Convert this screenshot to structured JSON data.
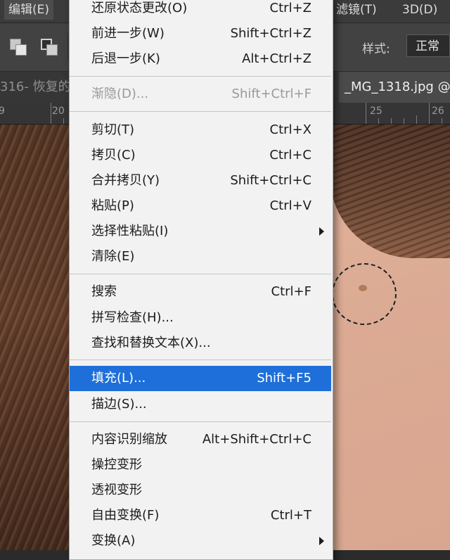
{
  "menubar": {
    "edit": "编辑(E)",
    "filter": "滤镜(T)",
    "threed": "3D(D)"
  },
  "options_bar": {
    "style_label": "样式:",
    "style_value": "正常"
  },
  "tabs": {
    "left": "316- 恢复的",
    "right": "_MG_1318.jpg @"
  },
  "ruler": {
    "labels": [
      "9",
      "20",
      "25",
      "26"
    ]
  },
  "edit_menu": {
    "items": [
      {
        "label": "还原状态更改(O)",
        "shortcut": "Ctrl+Z"
      },
      {
        "label": "前进一步(W)",
        "shortcut": "Shift+Ctrl+Z"
      },
      {
        "label": "后退一步(K)",
        "shortcut": "Alt+Ctrl+Z"
      },
      {
        "label": "渐隐(D)...",
        "shortcut": "Shift+Ctrl+F"
      },
      {
        "label": "剪切(T)",
        "shortcut": "Ctrl+X"
      },
      {
        "label": "拷贝(C)",
        "shortcut": "Ctrl+C"
      },
      {
        "label": "合并拷贝(Y)",
        "shortcut": "Shift+Ctrl+C"
      },
      {
        "label": "粘贴(P)",
        "shortcut": "Ctrl+V"
      },
      {
        "label": "选择性粘贴(I)",
        "shortcut": ""
      },
      {
        "label": "清除(E)",
        "shortcut": ""
      },
      {
        "label": "搜索",
        "shortcut": "Ctrl+F"
      },
      {
        "label": "拼写检查(H)...",
        "shortcut": ""
      },
      {
        "label": "查找和替换文本(X)...",
        "shortcut": ""
      },
      {
        "label": "填充(L)...",
        "shortcut": "Shift+F5"
      },
      {
        "label": "描边(S)...",
        "shortcut": ""
      },
      {
        "label": "内容识别缩放",
        "shortcut": "Alt+Shift+Ctrl+C"
      },
      {
        "label": "操控变形",
        "shortcut": ""
      },
      {
        "label": "透视变形",
        "shortcut": ""
      },
      {
        "label": "自由变换(F)",
        "shortcut": "Ctrl+T"
      },
      {
        "label": "变换(A)",
        "shortcut": ""
      }
    ]
  },
  "colors": {
    "highlight": "#1e6fd9",
    "menu_bg": "#f2f2f2",
    "app_bg": "#2b2b2b"
  }
}
